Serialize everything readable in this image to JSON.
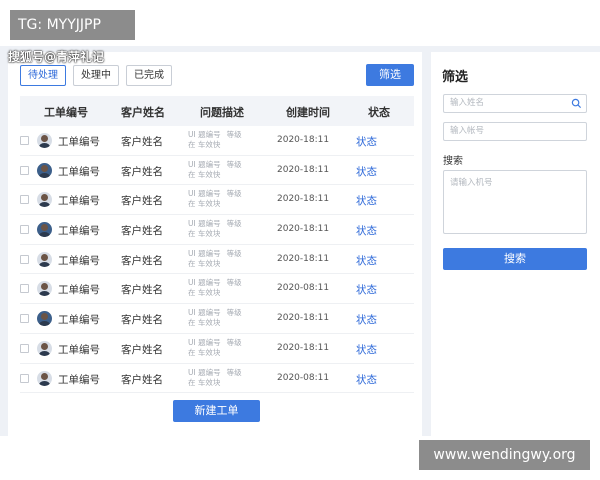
{
  "watermarks": {
    "tg": "TG: MYYJJPP",
    "sohu": "搜狐号@青萍礼记",
    "site": "www.wendingwy.org"
  },
  "tabs": [
    {
      "label": "待处理",
      "active": true
    },
    {
      "label": "处理中",
      "active": false
    },
    {
      "label": "已完成",
      "active": false
    }
  ],
  "toolbar": {
    "filter_label": "筛选"
  },
  "table": {
    "headers": [
      "工单编号",
      "客户姓名",
      "问题描述",
      "创建时间",
      "状态"
    ],
    "rows": [
      {
        "id": "工单编号",
        "customer": "客户姓名",
        "desc_line1": "UI 题编号",
        "desc_tag": "等级",
        "desc_line2": "在 车效快",
        "time": "2020-18:11",
        "status": "状态",
        "avatar": "light"
      },
      {
        "id": "工单编号",
        "customer": "客户姓名",
        "desc_line1": "UI 题编号",
        "desc_tag": "等级",
        "desc_line2": "在 车效快",
        "time": "2020-18:11",
        "status": "状态",
        "avatar": "dark"
      },
      {
        "id": "工单编号",
        "customer": "客户姓名",
        "desc_line1": "UI 题编号",
        "desc_tag": "等级",
        "desc_line2": "在 车效块",
        "time": "2020-18:11",
        "status": "状态",
        "avatar": "light"
      },
      {
        "id": "工单编号",
        "customer": "客户姓名",
        "desc_line1": "UI 题编号",
        "desc_tag": "等级",
        "desc_line2": "在 车效块",
        "time": "2020-18:11",
        "status": "状态",
        "avatar": "dark"
      },
      {
        "id": "工单编号",
        "customer": "客户姓名",
        "desc_line1": "UI 题编号",
        "desc_tag": "等级",
        "desc_line2": "在 车效块",
        "time": "2020-18:11",
        "status": "状态",
        "avatar": "light"
      },
      {
        "id": "工单编号",
        "customer": "客户姓名",
        "desc_line1": "UI 题编号",
        "desc_tag": "等级",
        "desc_line2": "在 车效块",
        "time": "2020-08:11",
        "status": "状态",
        "avatar": "light"
      },
      {
        "id": "工单编号",
        "customer": "客户姓名",
        "desc_line1": "UI 题编号",
        "desc_tag": "等级",
        "desc_line2": "在 车效块",
        "time": "2020-18:11",
        "status": "状态",
        "avatar": "dark"
      },
      {
        "id": "工单编号",
        "customer": "客户姓名",
        "desc_line1": "UI 题编号",
        "desc_tag": "等级",
        "desc_line2": "在 车效块",
        "time": "2020-18:11",
        "status": "状态",
        "avatar": "light"
      },
      {
        "id": "工单编号",
        "customer": "客户姓名",
        "desc_line1": "UI 题编号",
        "desc_tag": "等级",
        "desc_line2": "在 车效块",
        "time": "2020-08:11",
        "status": "状态",
        "avatar": "light"
      }
    ]
  },
  "new_ticket_label": "新建工单",
  "sidebar": {
    "title": "筛选",
    "name_placeholder": "输入姓名",
    "account_placeholder": "输入帐号",
    "search_label": "搜索",
    "phone_placeholder": "请输入机号",
    "search_button": "搜索"
  },
  "colors": {
    "accent": "#3d7ae0",
    "link": "#2f6ad9",
    "background": "#eef1f6"
  }
}
